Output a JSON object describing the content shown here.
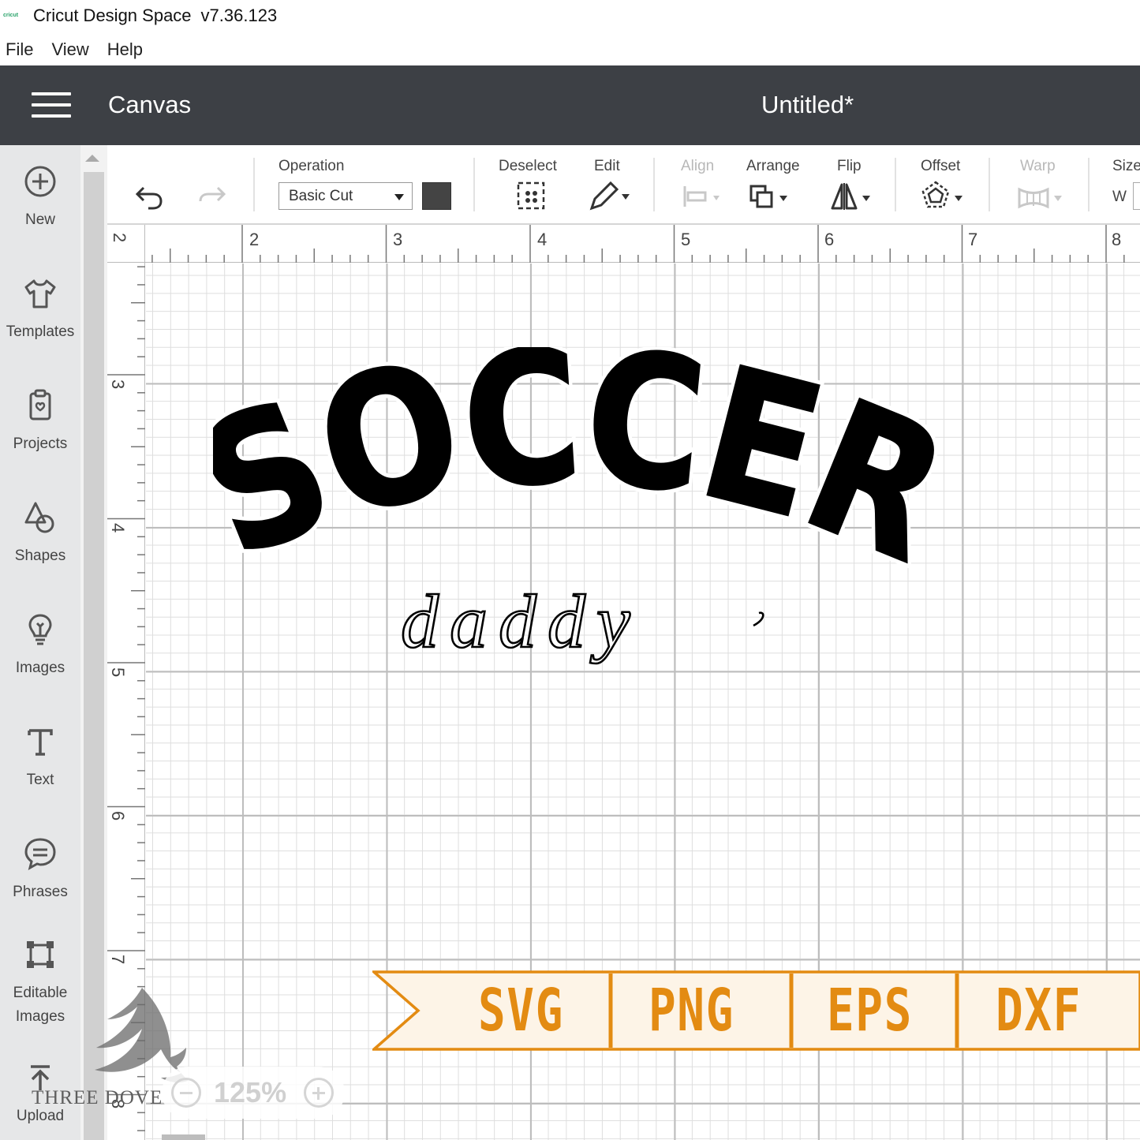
{
  "window": {
    "logo_text": "cricut",
    "title": "Cricut Design Space",
    "version": "v7.36.123"
  },
  "menu": [
    "File",
    "View",
    "Help"
  ],
  "header": {
    "title": "Canvas",
    "document": "Untitled*"
  },
  "sidebar": {
    "items": [
      {
        "label": "New",
        "icon": "plus-circle-icon"
      },
      {
        "label": "Templates",
        "icon": "shirt-icon"
      },
      {
        "label": "Projects",
        "icon": "clipboard-icon"
      },
      {
        "label": "Shapes",
        "icon": "shapes-icon"
      },
      {
        "label": "Images",
        "icon": "lightbulb-icon"
      },
      {
        "label": "Text",
        "icon": "text-icon"
      },
      {
        "label": "Phrases",
        "icon": "speech-bubble-icon"
      },
      {
        "label": "Editable",
        "label2": "Images",
        "icon": "editable-images-icon"
      },
      {
        "label": "Upload",
        "icon": "upload-icon"
      }
    ]
  },
  "toolbar": {
    "operation_label": "Operation",
    "operation_value": "Basic Cut",
    "swatch_color": "#444444",
    "deselect_label": "Deselect",
    "edit_label": "Edit",
    "align_label": "Align",
    "arrange_label": "Arrange",
    "flip_label": "Flip",
    "offset_label": "Offset",
    "warp_label": "Warp",
    "size_label": "Size",
    "size_w_label": "W"
  },
  "rulers": {
    "horizontal": [
      "2",
      "2",
      "3",
      "4",
      "5",
      "6",
      "7",
      "8"
    ],
    "vertical": [
      "3",
      "4",
      "5",
      "6",
      "7",
      "8"
    ]
  },
  "design": {
    "headline": "SOCCER",
    "script": "daddy"
  },
  "zoom": {
    "value": "125%"
  },
  "banner": {
    "formats": [
      "SVG",
      "PNG",
      "EPS",
      "DXF"
    ],
    "color": "#e38b12"
  },
  "watermark": {
    "text": "THREE DOVE"
  }
}
